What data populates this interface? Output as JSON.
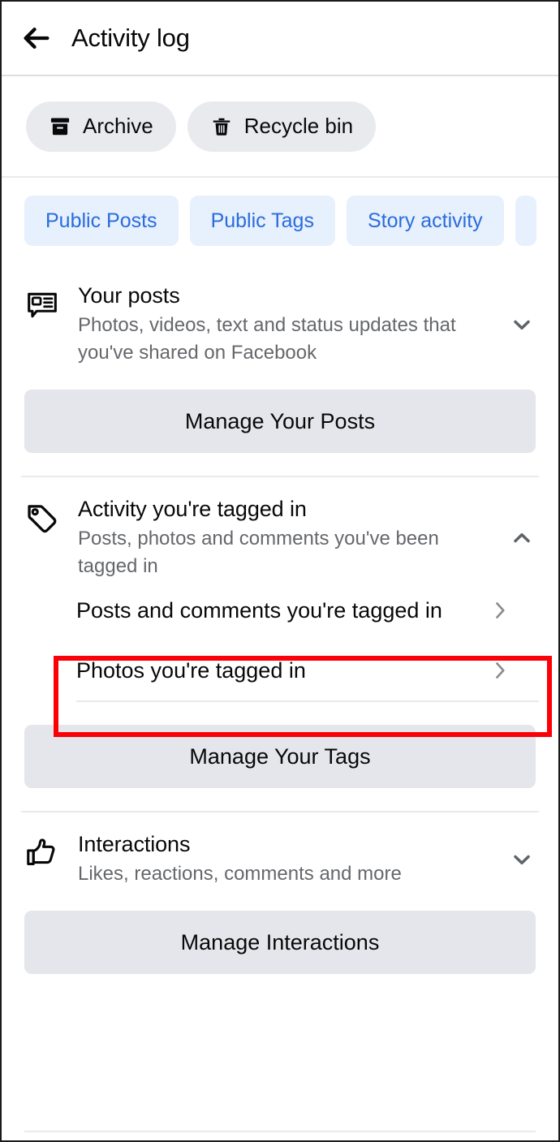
{
  "header": {
    "back_icon": "arrow-left-icon",
    "title": "Activity log"
  },
  "top_actions": [
    {
      "label": "Archive",
      "icon": "archive-box-icon"
    },
    {
      "label": "Recycle bin",
      "icon": "trash-icon"
    }
  ],
  "filter_chips": [
    {
      "label": "Public Posts"
    },
    {
      "label": "Public Tags"
    },
    {
      "label": "Story activity"
    },
    {
      "label": ""
    }
  ],
  "sections": [
    {
      "icon": "post-bubble-icon",
      "title": "Your posts",
      "subtitle": "Photos, videos, text and status updates that you've shared on Facebook",
      "chevron": "chevron-down-icon",
      "expanded": false,
      "manage_button": "Manage Your Posts",
      "sub_rows": []
    },
    {
      "icon": "tag-icon",
      "title": "Activity you're tagged in",
      "subtitle": "Posts, photos and comments you've been tagged in",
      "chevron": "chevron-up-icon",
      "expanded": true,
      "manage_button": "Manage Your Tags",
      "sub_rows": [
        {
          "label": "Posts and comments you're tagged in",
          "chevron": "chevron-right-icon",
          "highlighted": true
        },
        {
          "label": "Photos you're tagged in",
          "chevron": "chevron-right-icon",
          "highlighted": false
        }
      ]
    },
    {
      "icon": "thumbs-up-icon",
      "title": "Interactions",
      "subtitle": "Likes, reactions, comments and more",
      "chevron": "chevron-down-icon",
      "expanded": false,
      "manage_button": "Manage Interactions",
      "sub_rows": []
    }
  ],
  "colors": {
    "accent_blue": "#2a6cdd",
    "chip_bg": "#e7f0fd",
    "pill_bg": "#e8eaed",
    "button_bg": "#e4e6eb",
    "text_primary": "#080809",
    "text_secondary": "#65676b",
    "highlight_red": "#fb0007",
    "divider": "#e8eaed"
  }
}
